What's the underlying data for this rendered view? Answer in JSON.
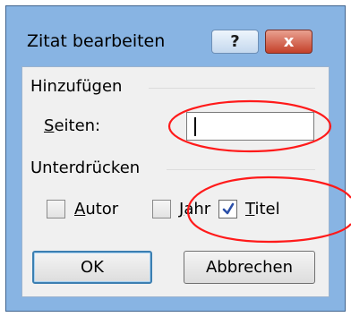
{
  "dialog": {
    "title": "Zitat bearbeiten",
    "help_button": "?",
    "close_button": "x"
  },
  "add_group": {
    "label": "Hinzufügen",
    "pages_label": "Seiten:",
    "pages_value": ""
  },
  "suppress_group": {
    "label": "Unterdrücken",
    "options": [
      {
        "label": "Autor",
        "checked": false
      },
      {
        "label": "Jahr",
        "checked": false
      },
      {
        "label": "Titel",
        "checked": true
      }
    ]
  },
  "buttons": {
    "ok": "OK",
    "cancel": "Abbrechen"
  },
  "annotation": {
    "color": "#ff1a1a"
  },
  "colors": {
    "frame": "#88b4e3",
    "close_red": "#c4402a",
    "dialog_bg": "#f0f0f0",
    "check_blue": "#2a4fa8"
  }
}
